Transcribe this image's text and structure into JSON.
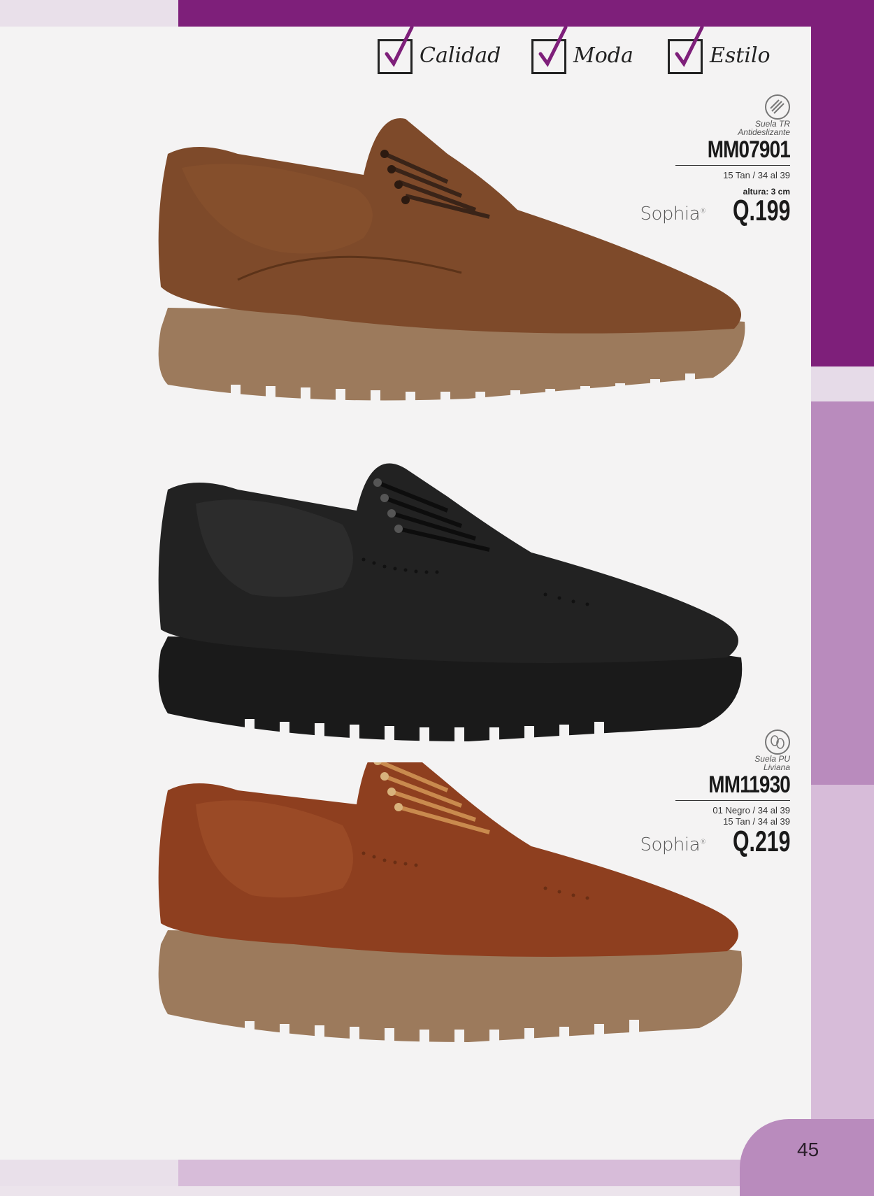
{
  "header": {
    "badges": [
      {
        "label": "Calidad"
      },
      {
        "label": "Moda"
      },
      {
        "label": "Estilo"
      }
    ]
  },
  "products": [
    {
      "sole_icon": "tread-sole-icon",
      "sole_text_line1": "Suela TR",
      "sole_text_line2": "Antideslizante",
      "code": "MM07901",
      "variants": [
        "15 Tan / 34 al 39"
      ],
      "height": "altura: 3 cm",
      "brand": "Sophia",
      "price": "Q.199",
      "color": "#8a4f2c"
    },
    {
      "sole_icon": "light-sole-icon",
      "sole_text_line1": "Suela PU",
      "sole_text_line2": "Liviana",
      "code": "MM11930",
      "variants": [
        "01 Negro / 34 al 39",
        "15 Tan / 34 al 39"
      ],
      "brand": "Sophia",
      "price": "Q.219",
      "colors": [
        "#1f1f1f",
        "#8e3f1f"
      ]
    }
  ],
  "footer": {
    "page_number": "45"
  },
  "colors": {
    "accent_dark": "#7e1f7a",
    "accent_mid": "#b98bbd",
    "accent_light": "#d7bcd9"
  }
}
